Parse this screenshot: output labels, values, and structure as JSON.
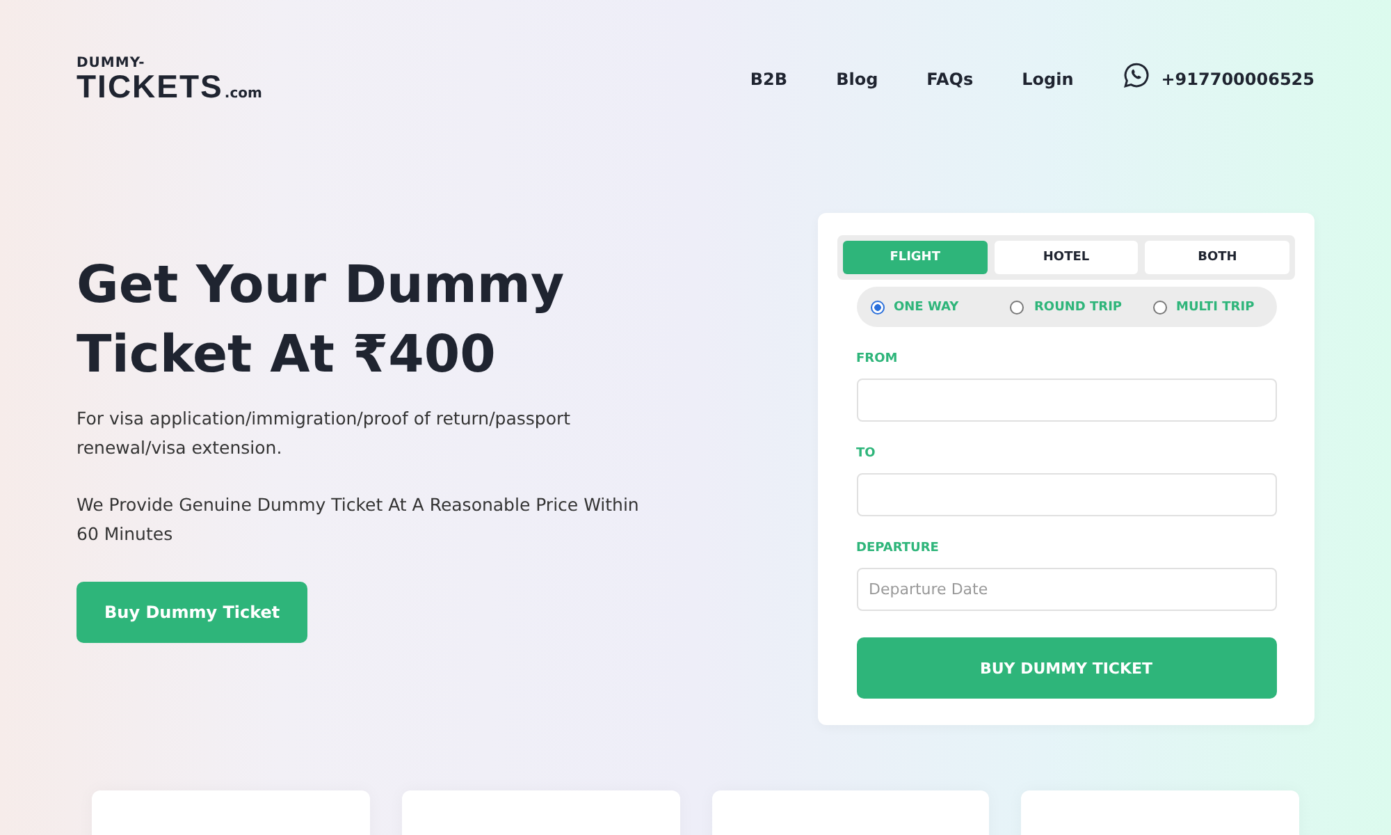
{
  "logo": {
    "top": "DUMMY-",
    "main": "TICKETS",
    "suffix": ".com"
  },
  "nav": {
    "links": [
      "B2B",
      "Blog",
      "FAQs",
      "Login"
    ],
    "phone": "+917700006525"
  },
  "hero": {
    "title": "Get Your Dummy Ticket At ₹400",
    "subtitle": "For visa application/immigration/proof of return/passport renewal/visa extension.",
    "text": "We Provide Genuine Dummy Ticket At A Reasonable Price Within 60 Minutes",
    "button": "Buy Dummy Ticket"
  },
  "booking": {
    "tabs": [
      {
        "label": "FLIGHT",
        "selected": true
      },
      {
        "label": "HOTEL",
        "selected": false
      },
      {
        "label": "BOTH",
        "selected": false
      }
    ],
    "trip_types": [
      {
        "label": "ONE WAY",
        "selected": true
      },
      {
        "label": "ROUND TRIP",
        "selected": false
      },
      {
        "label": "MULTI TRIP",
        "selected": false
      }
    ],
    "fields": [
      {
        "label": "FROM"
      },
      {
        "label": "TO"
      },
      {
        "label": "DEPARTURE",
        "placeholder": "Departure Date"
      }
    ],
    "submit": "BUY DUMMY TICKET"
  },
  "cards": [
    {
      "kind": "empty"
    },
    {
      "kind": "empty"
    },
    {
      "kind": "empty"
    },
    {
      "kind": "empty"
    }
  ]
}
